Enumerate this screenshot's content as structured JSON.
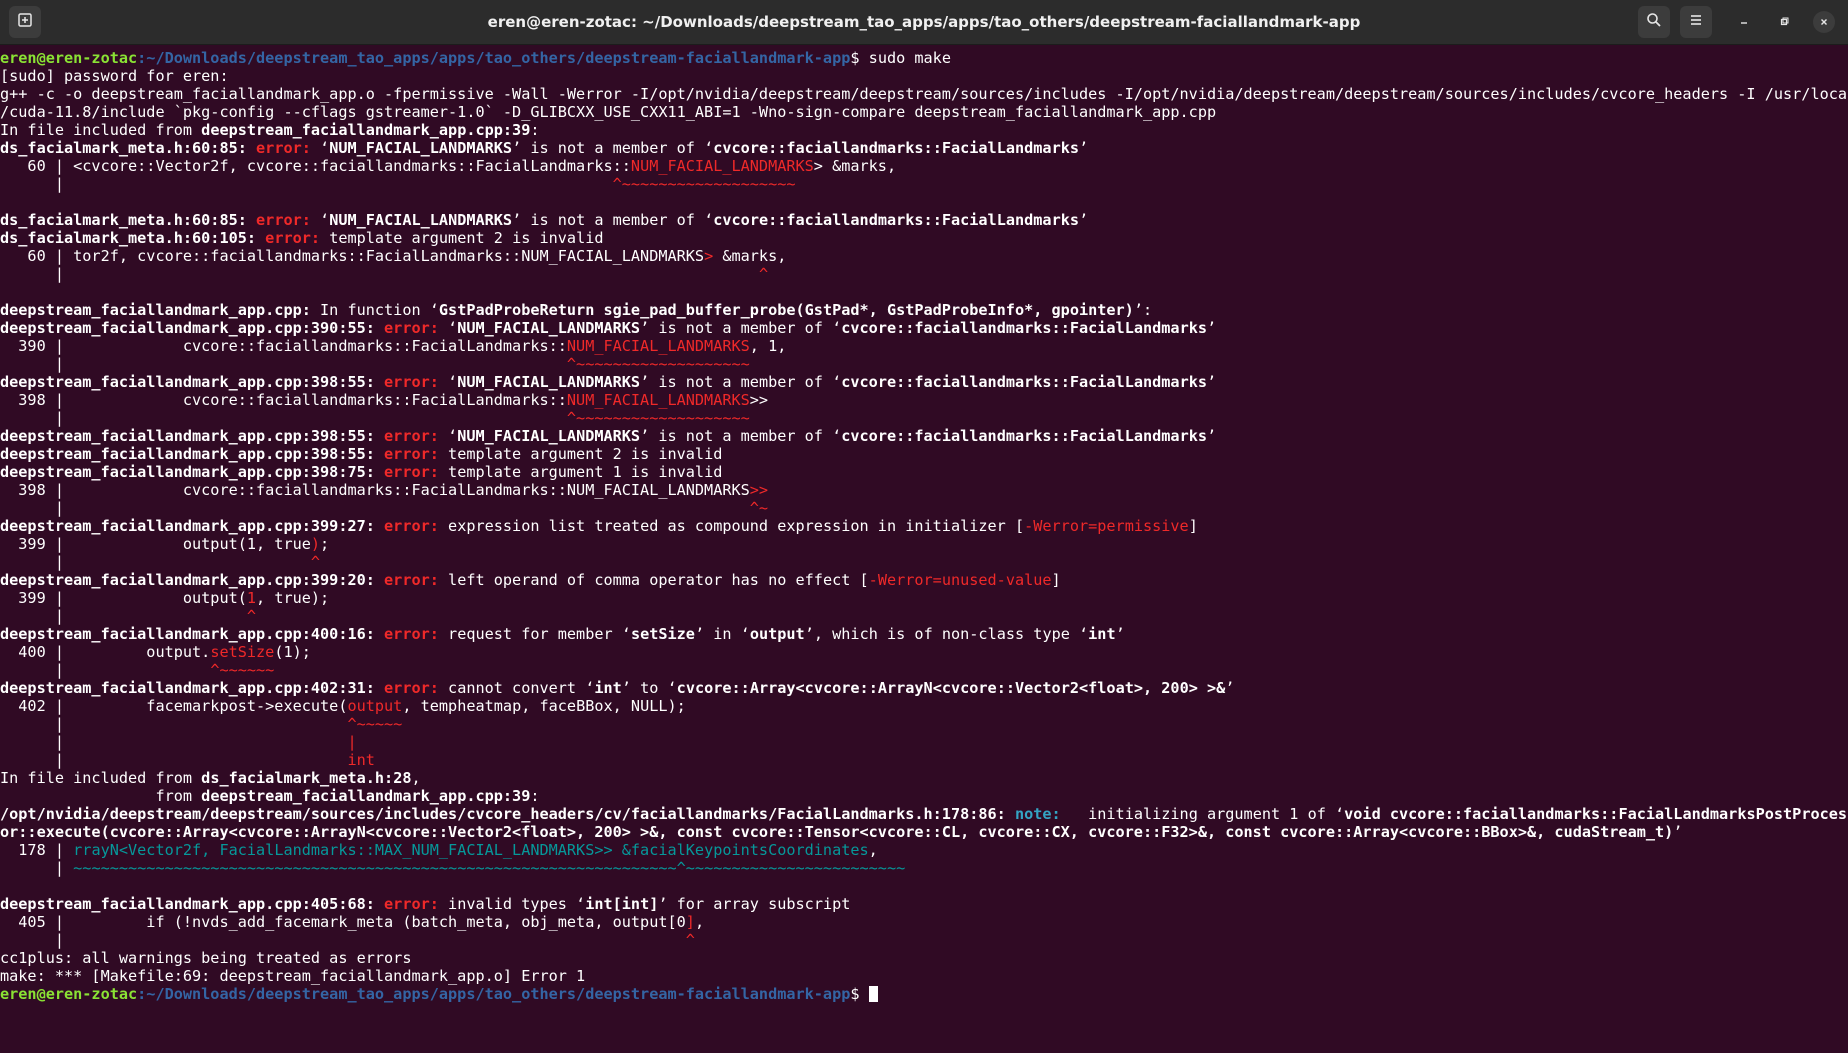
{
  "window": {
    "title": "eren@eren-zotac: ~/Downloads/deepstream_tao_apps/apps/tao_others/deepstream-faciallandmark-app"
  },
  "prompt": {
    "user_host": "eren@eren-zotac",
    "path": ":~/Downloads/deepstream_tao_apps/apps/tao_others/deepstream-faciallandmark-app",
    "symbol": "$",
    "command": " sudo make"
  },
  "lines": {
    "l2": "[sudo] password for eren:",
    "l3": "g++ -c -o deepstream_faciallandmark_app.o -fpermissive -Wall -Werror -I/opt/nvidia/deepstream/deepstream/sources/includes -I/opt/nvidia/deepstream/deepstream/sources/includes/cvcore_headers -I /usr/local",
    "l4": "/cuda-11.8/include `pkg-config --cflags gstreamer-1.0` -D_GLIBCXX_USE_CXX11_ABI=1 -Wno-sign-compare deepstream_faciallandmark_app.cpp",
    "l5a": "In file included from ",
    "l5b": "deepstream_faciallandmark_app.cpp:39",
    "l5c": ":",
    "l6a": "ds_facialmark_meta.h:60:85:",
    "l6b": " error:",
    "l6c": " ‘",
    "l6d": "NUM_FACIAL_LANDMARKS",
    "l6e": "’ is not a member of ‘",
    "l6f": "cvcore::faciallandmarks::FacialLandmarks",
    "l6g": "’",
    "l7a": "   60 | <cvcore::Vector2f, cvcore::faciallandmarks::FacialLandmarks::",
    "l7b": "NUM_FACIAL_LANDMARKS",
    "l7c": "> &marks,",
    "l8a": "      |                                                            ",
    "l8b": "^~~~~~~~~~~~~~~~~~~~",
    "l10a": "ds_facialmark_meta.h:60:85:",
    "l10b": " error:",
    "l10c": " ‘",
    "l10d": "NUM_FACIAL_LANDMARKS",
    "l10e": "’ is not a member of ‘",
    "l10f": "cvcore::faciallandmarks::FacialLandmarks",
    "l10g": "’",
    "l11a": "ds_facialmark_meta.h:60:105:",
    "l11b": " error:",
    "l11c": " template argument 2 is invalid",
    "l12a": "   60 | tor2f, cvcore::faciallandmarks::FacialLandmarks::NUM_FACIAL_LANDMARKS",
    "l12b": ">",
    "l12c": " &marks,",
    "l13a": "      |                                                                            ",
    "l13b": "^",
    "l15a": "deepstream_faciallandmark_app.cpp:",
    "l15b": " In function ‘",
    "l15c": "GstPadProbeReturn sgie_pad_buffer_probe(GstPad*, GstPadProbeInfo*, gpointer)",
    "l15d": "’:",
    "l16a": "deepstream_faciallandmark_app.cpp:390:55:",
    "l16b": " error:",
    "l16c": " ‘",
    "l16d": "NUM_FACIAL_LANDMARKS",
    "l16e": "’ is not a member of ‘",
    "l16f": "cvcore::faciallandmarks::FacialLandmarks",
    "l16g": "’",
    "l17a": "  390 |             cvcore::faciallandmarks::FacialLandmarks::",
    "l17b": "NUM_FACIAL_LANDMARKS",
    "l17c": ", 1,",
    "l18a": "      |                                                       ",
    "l18b": "^~~~~~~~~~~~~~~~~~~~",
    "l19a": "deepstream_faciallandmark_app.cpp:398:55:",
    "l19b": " error:",
    "l19c": " ‘",
    "l19d": "NUM_FACIAL_LANDMARKS",
    "l19e": "’ is not a member of ‘",
    "l19f": "cvcore::faciallandmarks::FacialLandmarks",
    "l19g": "’",
    "l20a": "  398 |             cvcore::faciallandmarks::FacialLandmarks::",
    "l20b": "NUM_FACIAL_LANDMARKS",
    "l20c": ">>",
    "l21a": "      |                                                       ",
    "l21b": "^~~~~~~~~~~~~~~~~~~~",
    "l22a": "deepstream_faciallandmark_app.cpp:398:55:",
    "l22b": " error:",
    "l22c": " ‘",
    "l22d": "NUM_FACIAL_LANDMARKS",
    "l22e": "’ is not a member of ‘",
    "l22f": "cvcore::faciallandmarks::FacialLandmarks",
    "l22g": "’",
    "l23a": "deepstream_faciallandmark_app.cpp:398:55:",
    "l23b": " error:",
    "l23c": " template argument 2 is invalid",
    "l24a": "deepstream_faciallandmark_app.cpp:398:75:",
    "l24b": " error:",
    "l24c": " template argument 1 is invalid",
    "l25a": "  398 |             cvcore::faciallandmarks::FacialLandmarks::NUM_FACIAL_LANDMARKS",
    "l25b": ">>",
    "l26a": "      |                                                                           ",
    "l26b": "^~",
    "l27a": "deepstream_faciallandmark_app.cpp:399:27:",
    "l27b": " error:",
    "l27c": " expression list treated as compound expression in initializer [",
    "l27d": "-Werror=permissive",
    "l27e": "]",
    "l28a": "  399 |             output(1, true",
    "l28b": ")",
    "l28c": ";",
    "l29a": "      |                           ",
    "l29b": "^",
    "l30a": "deepstream_faciallandmark_app.cpp:399:20:",
    "l30b": " error:",
    "l30c": " left operand of comma operator has no effect [",
    "l30d": "-Werror=unused-value",
    "l30e": "]",
    "l31a": "  399 |             output(",
    "l31b": "1",
    "l31c": ", true);",
    "l32a": "      |                    ",
    "l32b": "^",
    "l33a": "deepstream_faciallandmark_app.cpp:400:16:",
    "l33b": " error:",
    "l33c": " request for member ‘",
    "l33d": "setSize",
    "l33e": "’ in ‘",
    "l33f": "output",
    "l33g": "’, which is of non-class type ‘",
    "l33h": "int",
    "l33i": "’",
    "l34a": "  400 |         output.",
    "l34b": "setSize",
    "l34c": "(1);",
    "l35a": "      |                ",
    "l35b": "^~~~~~~",
    "l36a": "deepstream_faciallandmark_app.cpp:402:31:",
    "l36b": " error:",
    "l36c": " cannot convert ‘",
    "l36d": "int",
    "l36e": "’ to ‘",
    "l36f": "cvcore::Array<cvcore::ArrayN<cvcore::Vector2<float>, 200> >&",
    "l36g": "’",
    "l37a": "  402 |         facemarkpost->execute(",
    "l37b": "output",
    "l37c": ", tempheatmap, faceBBox, NULL);",
    "l38a": "      |                               ",
    "l38b": "^~~~~~",
    "l39a": "      |                               ",
    "l39b": "|",
    "l40a": "      |                               ",
    "l40b": "int",
    "l41a": "In file included from ",
    "l41b": "ds_facialmark_meta.h:28",
    "l41c": ",",
    "l42a": "                 from ",
    "l42b": "deepstream_faciallandmark_app.cpp:39",
    "l42c": ":",
    "l43a": "/opt/nvidia/deepstream/deepstream/sources/includes/cvcore_headers/cv/faciallandmarks/FacialLandmarks.h:178:86:",
    "l43b": " note:",
    "l43c": "   initializing argument 1 of ‘",
    "l43d": "void cvcore::faciallandmarks::FacialLandmarksPostProcess",
    "l44a": "or::execute(cvcore::Array<cvcore::ArrayN<cvcore::Vector2<float>, 200> >&, const cvcore::Tensor<cvcore::CL, cvcore::CX, cvcore::F32>&, const cvcore::Array<cvcore::BBox>&, cudaStream_t)",
    "l44b": "’",
    "l45a": "  178 | ",
    "l45b": "rrayN<Vector2f, FacialLandmarks::MAX_NUM_FACIAL_LANDMARKS>> &facialKeypointsCoordinates",
    "l45c": ",",
    "l46a": "      | ",
    "l46b": "~~~~~~~~~~~~~~~~~~~~~~~~~~~~~~~~~~~~~~~~~~~~~~~~~~~~~~~~~~~~~~~~~~^~~~~~~~~~~~~~~~~~~~~~~~~",
    "l48a": "deepstream_faciallandmark_app.cpp:405:68:",
    "l48b": " error:",
    "l48c": " invalid types ‘",
    "l48d": "int[int]",
    "l48e": "’ for array subscript",
    "l49a": "  405 |         if (!nvds_add_facemark_meta (batch_meta, obj_meta, output[0",
    "l49b": "]",
    "l49c": ",",
    "l50a": "      |                                                                    ",
    "l50b": "^",
    "l51": "cc1plus: all warnings being treated as errors",
    "l52": "make: *** [Makefile:69: deepstream_faciallandmark_app.o] Error 1"
  },
  "colors": {
    "background": "#300a24",
    "prompt_user": "#8ae234",
    "prompt_path": "#3465a4",
    "error": "#ef2929",
    "note": "#34a4c4"
  }
}
